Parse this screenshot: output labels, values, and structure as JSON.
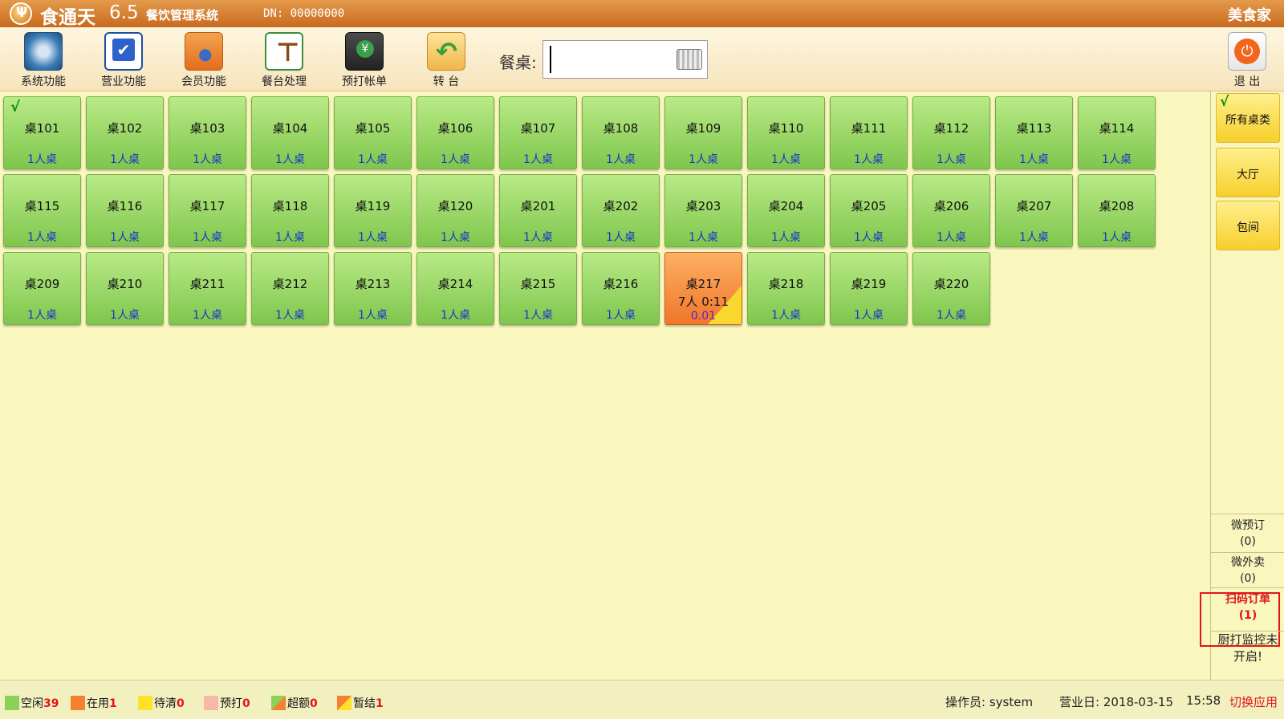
{
  "titlebar": {
    "app_name": "食通天",
    "version": "6.5",
    "subtitle": "餐饮管理系统",
    "dn": "DN: 00000000",
    "brand": "美食家"
  },
  "toolbar": {
    "tools": [
      {
        "label": "系统功能",
        "icon": "gear-icon"
      },
      {
        "label": "营业功能",
        "icon": "checkbox-icon"
      },
      {
        "label": "会员功能",
        "icon": "member-icon"
      },
      {
        "label": "餐台处理",
        "icon": "dining-table-icon"
      },
      {
        "label": "预打帐单",
        "icon": "bill-print-icon"
      },
      {
        "label": "转 台",
        "icon": "transfer-folder-icon"
      }
    ],
    "search_label": "餐桌:",
    "search_value": "",
    "exit_label": "退 出"
  },
  "tables": [
    {
      "name": "桌101",
      "capacity": "1人桌",
      "status": "free",
      "selected": true
    },
    {
      "name": "桌102",
      "capacity": "1人桌",
      "status": "free"
    },
    {
      "name": "桌103",
      "capacity": "1人桌",
      "status": "free"
    },
    {
      "name": "桌104",
      "capacity": "1人桌",
      "status": "free"
    },
    {
      "name": "桌105",
      "capacity": "1人桌",
      "status": "free"
    },
    {
      "name": "桌106",
      "capacity": "1人桌",
      "status": "free"
    },
    {
      "name": "桌107",
      "capacity": "1人桌",
      "status": "free"
    },
    {
      "name": "桌108",
      "capacity": "1人桌",
      "status": "free"
    },
    {
      "name": "桌109",
      "capacity": "1人桌",
      "status": "free"
    },
    {
      "name": "桌110",
      "capacity": "1人桌",
      "status": "free"
    },
    {
      "name": "桌111",
      "capacity": "1人桌",
      "status": "free"
    },
    {
      "name": "桌112",
      "capacity": "1人桌",
      "status": "free"
    },
    {
      "name": "桌113",
      "capacity": "1人桌",
      "status": "free"
    },
    {
      "name": "桌114",
      "capacity": "1人桌",
      "status": "free"
    },
    {
      "name": "桌115",
      "capacity": "1人桌",
      "status": "free"
    },
    {
      "name": "桌116",
      "capacity": "1人桌",
      "status": "free"
    },
    {
      "name": "桌117",
      "capacity": "1人桌",
      "status": "free"
    },
    {
      "name": "桌118",
      "capacity": "1人桌",
      "status": "free"
    },
    {
      "name": "桌119",
      "capacity": "1人桌",
      "status": "free"
    },
    {
      "name": "桌120",
      "capacity": "1人桌",
      "status": "free"
    },
    {
      "name": "桌201",
      "capacity": "1人桌",
      "status": "free"
    },
    {
      "name": "桌202",
      "capacity": "1人桌",
      "status": "free"
    },
    {
      "name": "桌203",
      "capacity": "1人桌",
      "status": "free"
    },
    {
      "name": "桌204",
      "capacity": "1人桌",
      "status": "free"
    },
    {
      "name": "桌205",
      "capacity": "1人桌",
      "status": "free"
    },
    {
      "name": "桌206",
      "capacity": "1人桌",
      "status": "free"
    },
    {
      "name": "桌207",
      "capacity": "1人桌",
      "status": "free"
    },
    {
      "name": "桌208",
      "capacity": "1人桌",
      "status": "free"
    },
    {
      "name": "桌209",
      "capacity": "1人桌",
      "status": "free"
    },
    {
      "name": "桌210",
      "capacity": "1人桌",
      "status": "free"
    },
    {
      "name": "桌211",
      "capacity": "1人桌",
      "status": "free"
    },
    {
      "name": "桌212",
      "capacity": "1人桌",
      "status": "free"
    },
    {
      "name": "桌213",
      "capacity": "1人桌",
      "status": "free"
    },
    {
      "name": "桌214",
      "capacity": "1人桌",
      "status": "free"
    },
    {
      "name": "桌215",
      "capacity": "1人桌",
      "status": "free"
    },
    {
      "name": "桌216",
      "capacity": "1人桌",
      "status": "free"
    },
    {
      "name": "桌217",
      "info": "7人 0:11",
      "amount": "0.01",
      "status": "occupied"
    },
    {
      "name": "桌218",
      "capacity": "1人桌",
      "status": "free"
    },
    {
      "name": "桌219",
      "capacity": "1人桌",
      "status": "free"
    },
    {
      "name": "桌220",
      "capacity": "1人桌",
      "status": "free"
    }
  ],
  "categories": [
    {
      "label": "所有桌类",
      "selected": true
    },
    {
      "label": "大厅"
    },
    {
      "label": "包间"
    }
  ],
  "side_panel": {
    "wechat_reserve": "微预订",
    "wechat_reserve_count": "(0)",
    "wechat_takeout": "微外卖",
    "wechat_takeout_count": "(0)",
    "scan_order": "扫码订单",
    "scan_order_count": "(1)",
    "kitchen_note_1": "厨打监控未",
    "kitchen_note_2": "开启!"
  },
  "status_bar": {
    "legend": [
      {
        "label": "空闲",
        "count": "39",
        "swatch": "free"
      },
      {
        "label": "在用",
        "count": "1",
        "swatch": "use"
      },
      {
        "label": "待清",
        "count": "0",
        "swatch": "clean"
      },
      {
        "label": "预打",
        "count": "0",
        "swatch": "pre"
      },
      {
        "label": "超额",
        "count": "0",
        "swatch": "over"
      },
      {
        "label": "暂结",
        "count": "1",
        "swatch": "temp"
      }
    ],
    "operator": "操作员: system",
    "business_day": "营业日: 2018-03-15",
    "time": "15:58",
    "switch_app": "切换应用"
  },
  "colors": {
    "title_bar": "#d27a28",
    "free_table": "#8cd05a",
    "occupied_table": "#f4812f",
    "category_button": "#f7cf2c",
    "highlight": "#e0161a",
    "background": "#f9f7bd"
  }
}
